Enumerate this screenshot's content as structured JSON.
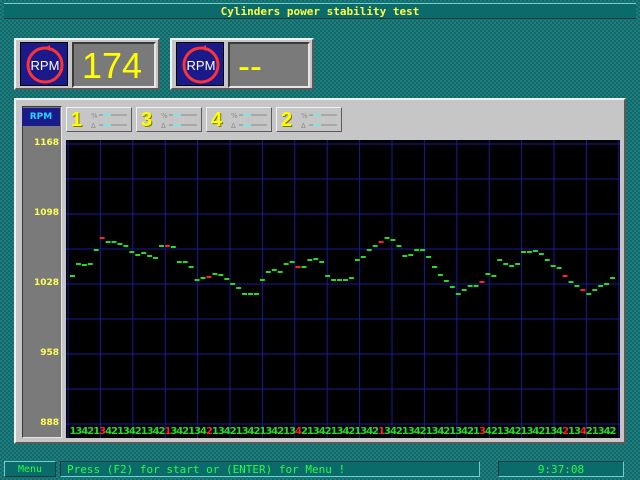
{
  "title": "Cylinders power stability test",
  "gauges": [
    {
      "icon": "rpm-dial-icon",
      "label": "RPM",
      "value": "174"
    },
    {
      "icon": "rpm-dial-icon",
      "label": "RPM",
      "value": "--"
    }
  ],
  "cylinder_tabs": [
    {
      "number": "1",
      "indicator": "cylinder-status-icon"
    },
    {
      "number": "3",
      "indicator": "cylinder-status-icon"
    },
    {
      "number": "4",
      "indicator": "cylinder-status-icon"
    },
    {
      "number": "2",
      "indicator": "cylinder-status-icon"
    }
  ],
  "chart_data": {
    "type": "scatter",
    "ylabel": "RPM",
    "ylim": [
      888,
      1168
    ],
    "yticks": [
      "1168",
      "1098",
      "1028",
      "958",
      "888"
    ],
    "grid": true,
    "cylinder_order": [
      "1",
      "3",
      "4",
      "2"
    ],
    "x_labels": [
      "1",
      "3",
      "4",
      "2",
      "1",
      "3",
      "4",
      "2",
      "1",
      "3",
      "4",
      "2",
      "1",
      "3",
      "4",
      "2",
      "1",
      "3",
      "4",
      "2",
      "1",
      "3",
      "4",
      "2",
      "1",
      "3",
      "4",
      "2",
      "1",
      "3",
      "4",
      "2",
      "1",
      "3",
      "4",
      "2",
      "1",
      "3",
      "4",
      "2",
      "1",
      "3",
      "4",
      "2",
      "1",
      "3",
      "4",
      "2",
      "1",
      "3",
      "4",
      "2",
      "1",
      "3",
      "4",
      "2",
      "1",
      "3",
      "4",
      "2",
      "1",
      "3",
      "4",
      "2",
      "1",
      "3",
      "4",
      "2",
      "1",
      "3",
      "4",
      "2",
      "1",
      "3",
      "4",
      "2",
      "1",
      "3",
      "4",
      "2",
      "1",
      "3",
      "4",
      "2",
      "1",
      "3",
      "4",
      "2",
      "1",
      "3",
      "4",
      "2"
    ],
    "highlight_color": "#ff2222",
    "normal_color": "#22dd22",
    "highlighted_indices": [
      5,
      16,
      23,
      38,
      52,
      69,
      83,
      86
    ],
    "values": [
      1036,
      1048,
      1047,
      1048,
      1062,
      1074,
      1070,
      1070,
      1068,
      1066,
      1060,
      1057,
      1059,
      1056,
      1054,
      1066,
      1066,
      1065,
      1050,
      1050,
      1045,
      1032,
      1034,
      1035,
      1038,
      1037,
      1033,
      1028,
      1024,
      1018,
      1018,
      1018,
      1032,
      1040,
      1042,
      1040,
      1048,
      1050,
      1045,
      1045,
      1052,
      1053,
      1050,
      1036,
      1032,
      1032,
      1032,
      1034,
      1052,
      1055,
      1062,
      1066,
      1070,
      1074,
      1072,
      1066,
      1056,
      1057,
      1062,
      1062,
      1055,
      1045,
      1037,
      1031,
      1025,
      1018,
      1022,
      1026,
      1026,
      1030,
      1038,
      1036,
      1052,
      1048,
      1046,
      1048,
      1060,
      1060,
      1061,
      1058,
      1052,
      1046,
      1044,
      1036,
      1030,
      1026,
      1022,
      1018,
      1022,
      1026,
      1028,
      1034
    ],
    "series": [
      {
        "name": "RPM",
        "color": "#22dd22"
      }
    ]
  },
  "menu_label": "Menu",
  "status_message": "Press (F2) for start or (ENTER) for Menu !",
  "clock": "9:37:08"
}
